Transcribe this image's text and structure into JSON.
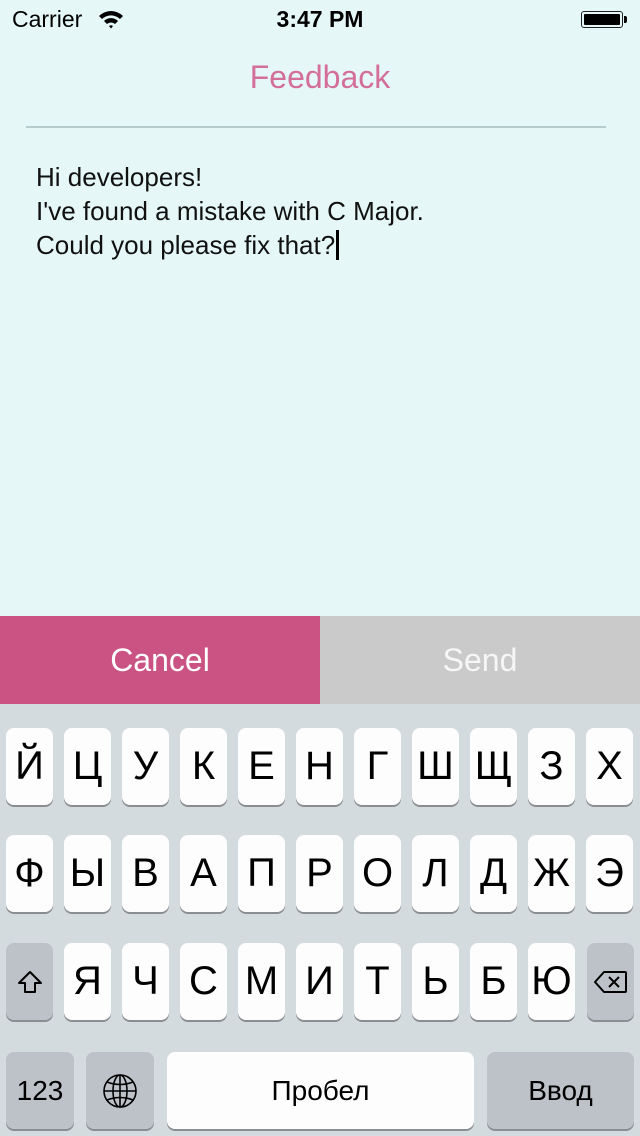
{
  "status_bar": {
    "carrier": "Carrier",
    "wifi_icon": "wifi-icon",
    "time": "3:47 PM",
    "battery_icon": "battery-full-icon"
  },
  "header": {
    "title": "Feedback"
  },
  "message": {
    "lines": [
      "Hi developers!",
      "I've found a mistake with C Major.",
      "Could you please fix that?"
    ]
  },
  "actions": {
    "cancel_label": "Cancel",
    "send_label": "Send",
    "send_enabled": false
  },
  "colors": {
    "background": "#e5f7f7",
    "title": "#d36f99",
    "cancel": "#cb5383",
    "send_disabled": "#cacaca",
    "keyboard": "#d4dbdf"
  },
  "keyboard": {
    "rows": [
      [
        "Й",
        "Ц",
        "У",
        "К",
        "Е",
        "Н",
        "Г",
        "Ш",
        "Щ",
        "З",
        "Х"
      ],
      [
        "Ф",
        "Ы",
        "В",
        "А",
        "П",
        "Р",
        "О",
        "Л",
        "Д",
        "Ж",
        "Э"
      ],
      [
        "Я",
        "Ч",
        "С",
        "М",
        "И",
        "Т",
        "Ь",
        "Б",
        "Ю"
      ]
    ],
    "shift_icon": "shift-icon",
    "backspace_icon": "backspace-icon",
    "numbers_label": "123",
    "globe_icon": "globe-icon",
    "space_label": "Пробел",
    "return_label": "Ввод"
  }
}
